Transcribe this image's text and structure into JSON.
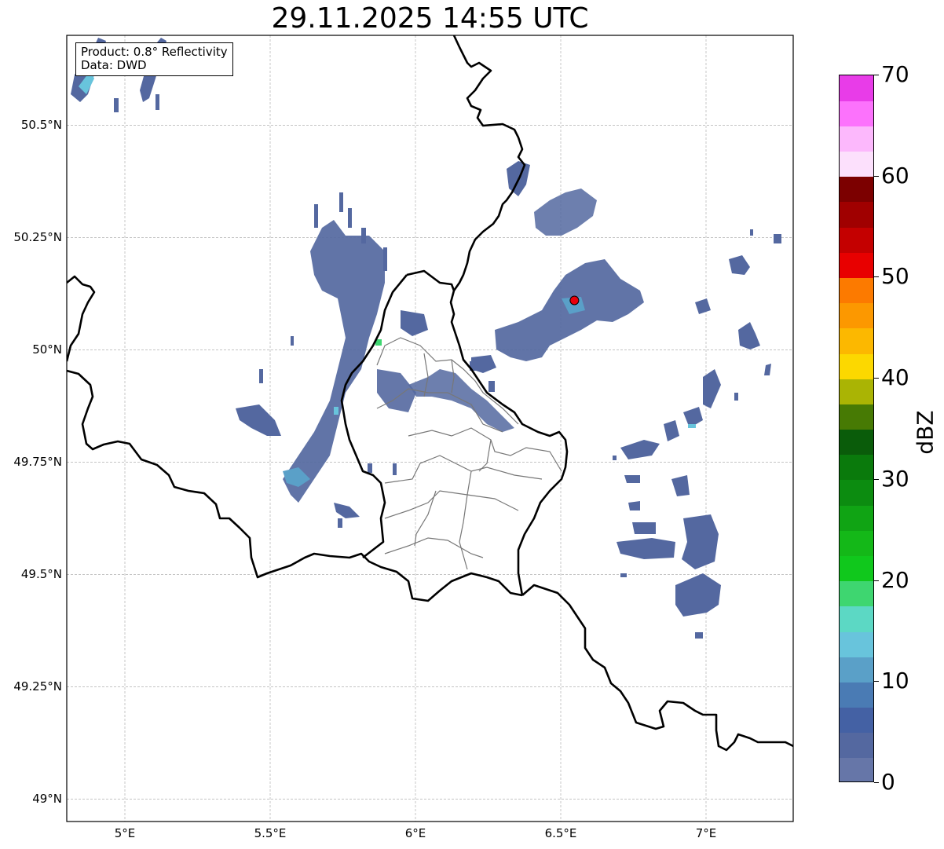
{
  "title": "29.11.2025 14:55 UTC",
  "info": {
    "product": "Product: 0.8° Reflectivity",
    "data": "Data: DWD"
  },
  "axes": {
    "lat_ticks": [
      {
        "value": 50.5,
        "label": "50.5°N"
      },
      {
        "value": 50.25,
        "label": "50.25°N"
      },
      {
        "value": 50.0,
        "label": "50°N"
      },
      {
        "value": 49.75,
        "label": "49.75°N"
      },
      {
        "value": 49.5,
        "label": "49.5°N"
      },
      {
        "value": 49.25,
        "label": "49.25°N"
      },
      {
        "value": 49.0,
        "label": "49°N"
      }
    ],
    "lon_ticks": [
      {
        "value": 5.0,
        "label": "5°E"
      },
      {
        "value": 5.5,
        "label": "5.5°E"
      },
      {
        "value": 6.0,
        "label": "6°E"
      },
      {
        "value": 6.5,
        "label": "6.5°E"
      },
      {
        "value": 7.0,
        "label": "7°E"
      }
    ],
    "lon_range": [
      4.8,
      7.3
    ],
    "lat_range": [
      48.95,
      50.7
    ],
    "grid": true
  },
  "radar_site": {
    "lon": 6.547,
    "lat": 50.11,
    "color": "#e8000b"
  },
  "colorbar": {
    "unit": "dBZ",
    "range": [
      0,
      70
    ],
    "tick_labels": [
      "0",
      "10",
      "20",
      "30",
      "40",
      "50",
      "60",
      "70"
    ],
    "colors": [
      "#6676a8",
      "#5468a0",
      "#4461a4",
      "#4a7bb4",
      "#5aa0c8",
      "#68c4dc",
      "#5cd8c4",
      "#3ed670",
      "#10c81c",
      "#14b818",
      "#10a414",
      "#0c8c10",
      "#0a7a0c",
      "#0a5c0a",
      "#477a04",
      "#aab404",
      "#fcd800",
      "#fcb800",
      "#fc9800",
      "#fc7a00",
      "#e80000",
      "#c40000",
      "#a00000",
      "#7c0000",
      "#fce0fc",
      "#fcb8fc",
      "#fc72fc",
      "#e83ce8"
    ]
  }
}
